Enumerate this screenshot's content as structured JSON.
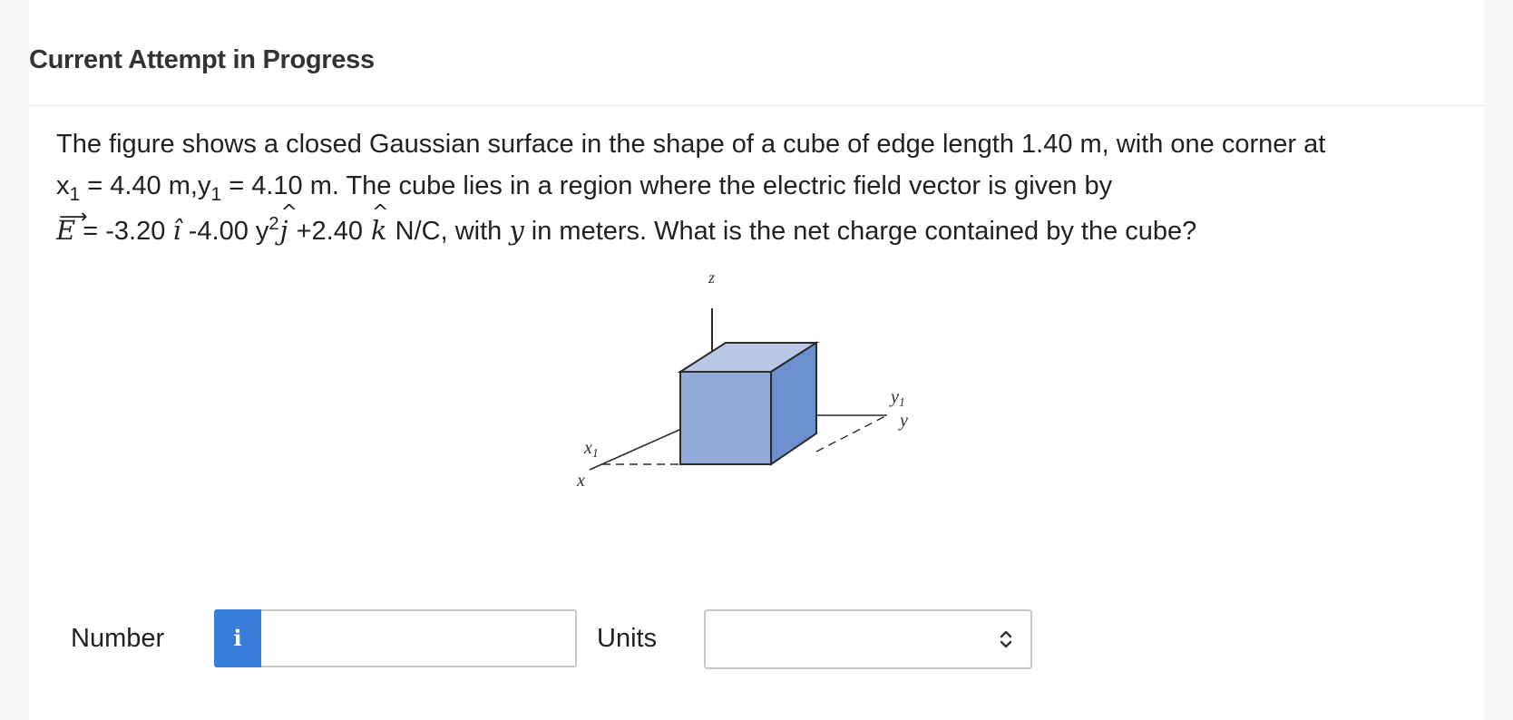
{
  "header": {
    "title": "Current Attempt in Progress"
  },
  "question": {
    "line1": "The figure shows a closed Gaussian surface in the shape of a cube of edge length 1.40 m, with one corner at",
    "line2": {
      "x_var": "x",
      "x_sub": "1",
      "x_text": " = 4.40 m,",
      "y_var": "y",
      "y_sub": "1",
      "y_text": " = 4.10 m. The cube lies in a region where the electric field vector is given by"
    },
    "line3": {
      "e_symbol": "E",
      "arrow": "⟶",
      "eq_part1": " = -3.20 ",
      "i_hat": "î",
      "eq_part2": " -4.00 y",
      "y_exp": "2",
      "j_hat": "j",
      "hat_glyph": "^",
      "eq_part3": " +2.40 ",
      "k_hat": "k",
      "eq_part4": " N/C, with ",
      "y_var": "y",
      "eq_part5": " in meters. What is the net charge contained by the cube?"
    }
  },
  "figure": {
    "z_label": "z",
    "y_label": "y",
    "y1_label": "y",
    "y1_sub": "1",
    "x_label": "x",
    "x1_label": "x",
    "x1_sub": "1",
    "colors": {
      "front": "#93a9d8",
      "top": "#b9c8e6",
      "side": "#6c8fcd",
      "edge": "#2b2b2b"
    }
  },
  "answer": {
    "number_label": "Number",
    "info_icon_glyph": "i",
    "number_value": "",
    "units_label": "Units",
    "units_value": ""
  }
}
